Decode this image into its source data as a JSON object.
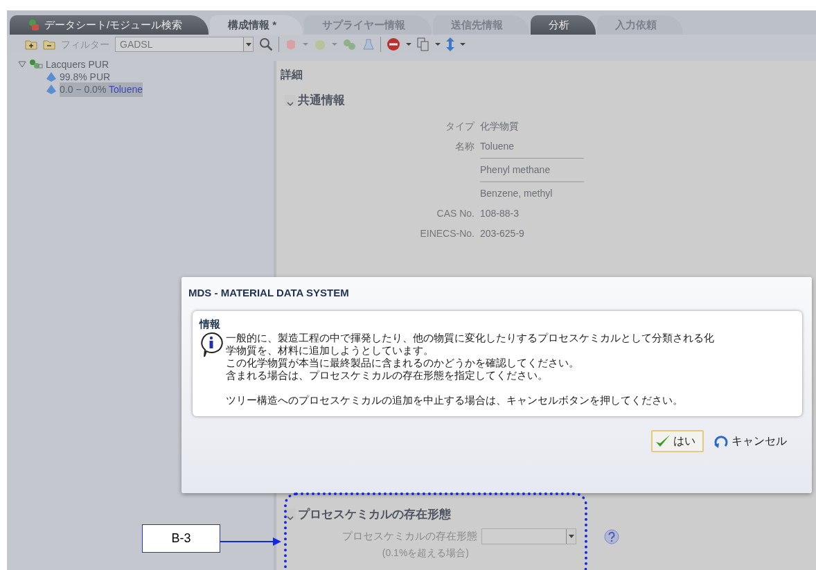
{
  "tabs": [
    {
      "label": "データシート/モジュール検索",
      "selected": false,
      "disabled": false,
      "icon": true
    },
    {
      "label": "構成情報 *",
      "selected": true,
      "disabled": false,
      "icon": false
    },
    {
      "label": "サプライヤー情報",
      "selected": false,
      "disabled": true,
      "icon": false
    },
    {
      "label": "送信先情報",
      "selected": false,
      "disabled": true,
      "icon": false
    },
    {
      "label": "分析",
      "selected": false,
      "disabled": false,
      "icon": false
    },
    {
      "label": "入力依頼",
      "selected": false,
      "disabled": true,
      "icon": false
    }
  ],
  "toolbar": {
    "filter_label": "フィルター",
    "filter_value": "GADSL"
  },
  "tree": [
    {
      "label": "Lacquers PUR",
      "expanded": true,
      "selected": false,
      "children": [
        {
          "amount": "99.8%",
          "name": "PUR",
          "selected": false
        },
        {
          "amount": "0.0 − 0.0%",
          "name": "Toluene",
          "selected": true
        }
      ]
    }
  ],
  "details": {
    "title": "詳細",
    "section": {
      "title": "共通情報",
      "expanded": true
    },
    "fields": [
      {
        "label": "タイプ",
        "values": [
          "化学物質"
        ]
      },
      {
        "label": "名称",
        "values": [
          "Toluene",
          "Phenyl methane",
          "Benzene, methyl"
        ]
      },
      {
        "label": "CAS No.",
        "values": [
          "108-88-3"
        ]
      },
      {
        "label": "EINECS-No.",
        "values": [
          "203-625-9"
        ]
      }
    ]
  },
  "dialog": {
    "title": "MDS - MATERIAL DATA SYSTEM",
    "panel_title": "情報",
    "message_blocks": [
      {
        "lines": [
          "一般的に、製造工程の中で揮発したり、他の物質に変化したりするプロセスケミカルとして分類される化学物質を、材料に追加しようとしています。",
          "この化学物質が本当に最終製品に含まれるのかどうかを確認してください。",
          "含まれる場合は、プロセスケミカルの存在形態を指定してください。"
        ]
      },
      {
        "lines": [
          "ツリー構造へのプロセスケミカルの追加を中止する場合は、キャンセルボタンを押してください。"
        ]
      }
    ],
    "buttons": [
      {
        "label": "はい",
        "kind": "ok",
        "focused": true
      },
      {
        "label": "キャンセル",
        "kind": "cancel",
        "focused": false
      }
    ]
  },
  "process_section": {
    "title": "プロセスケミカルの存在形態",
    "expanded": true,
    "field_label": "プロセスケミカルの存在形態",
    "field_note": "(0.1%を超える場合)"
  },
  "annotation": {
    "label": "B-3"
  }
}
